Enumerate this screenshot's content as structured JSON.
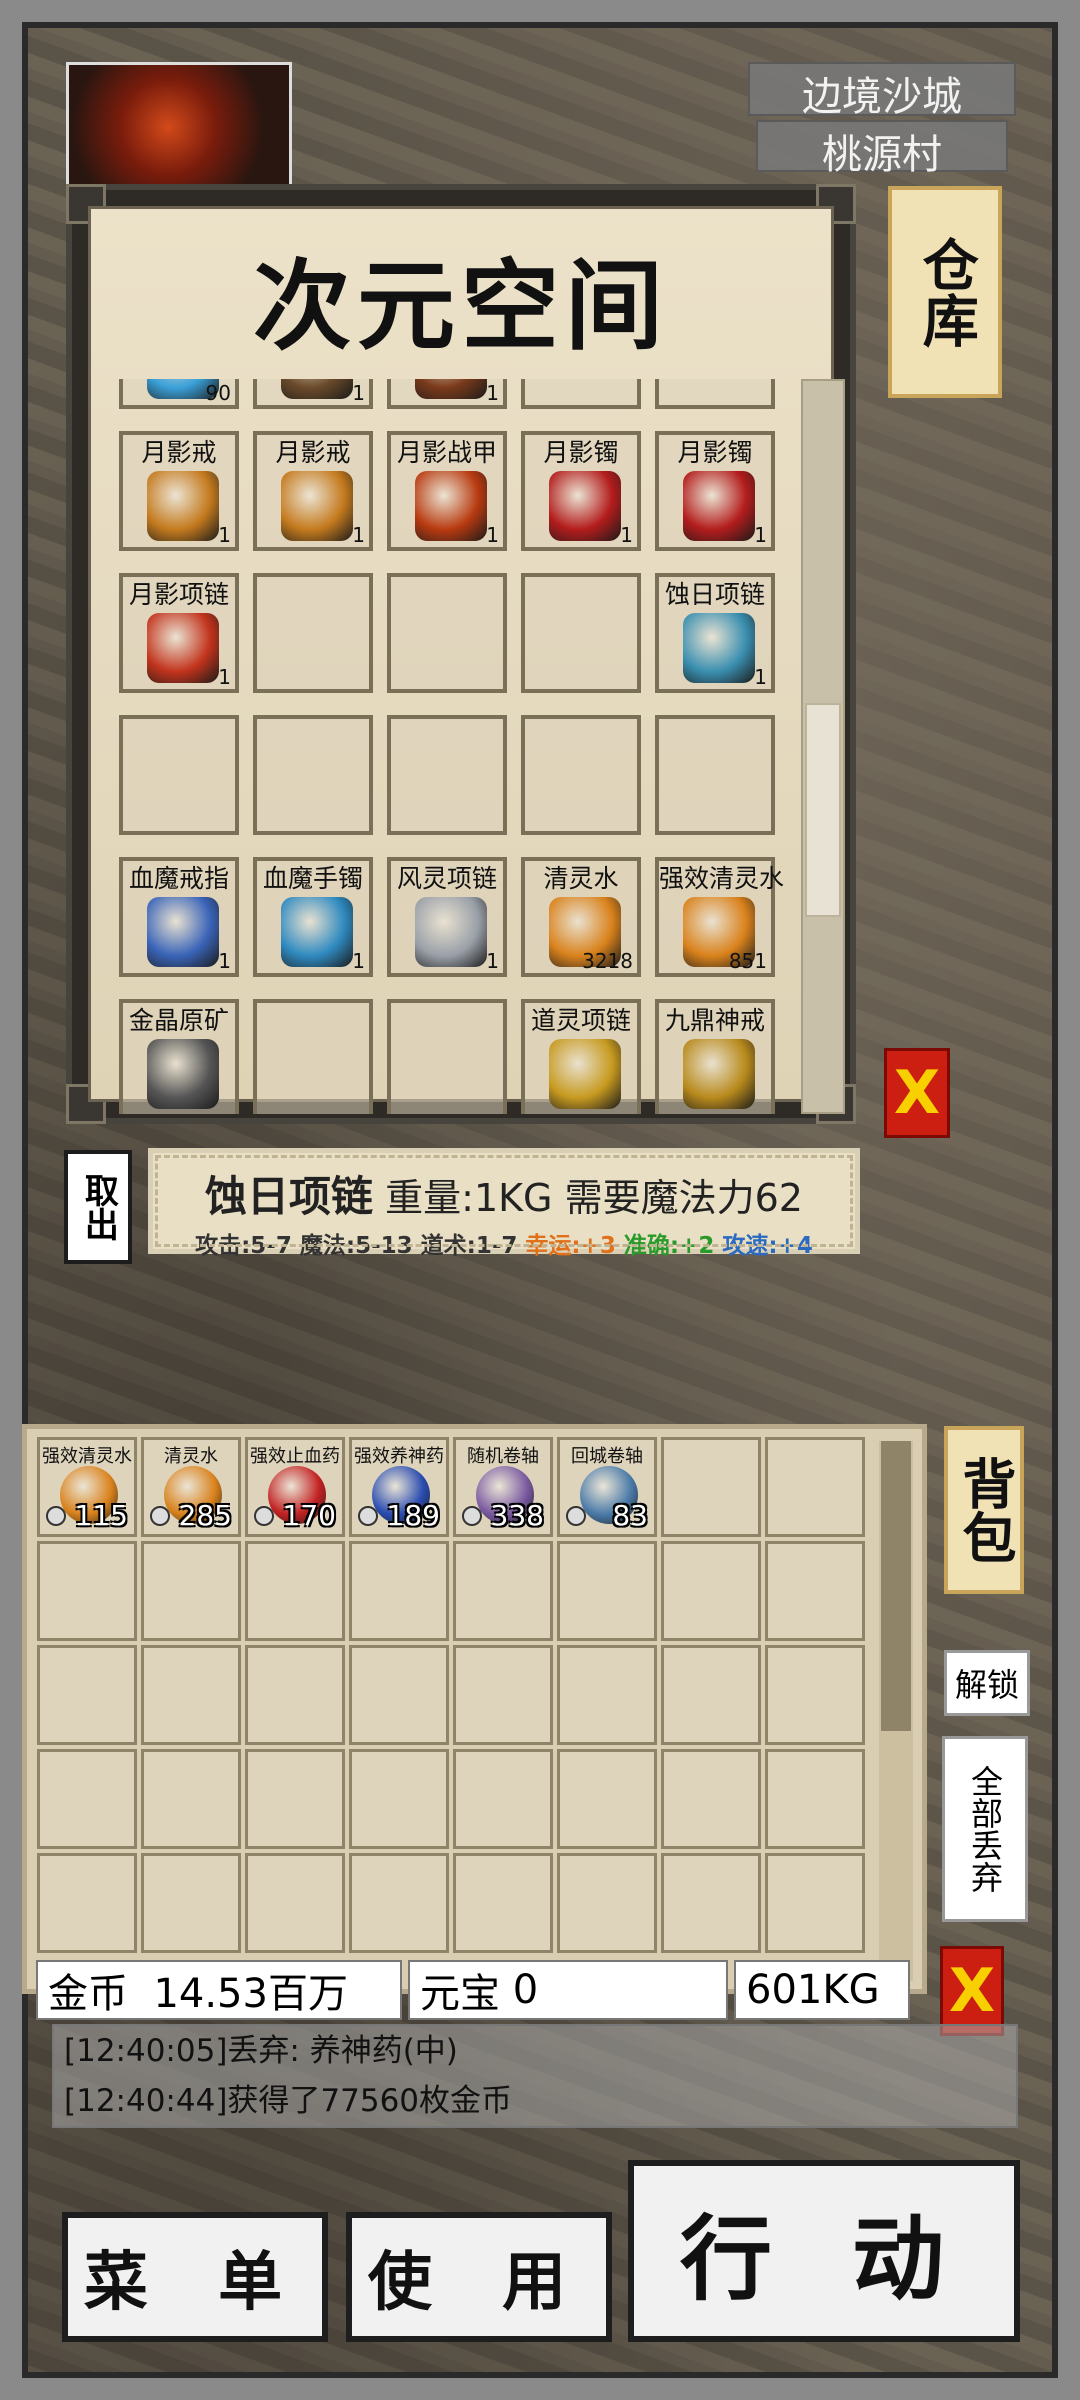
{
  "map": {
    "region": "边境沙城",
    "village": "桃源村"
  },
  "storage": {
    "title": "次元空间",
    "side_button": "仓库",
    "close": "X",
    "rows": [
      [
        {
          "name": "",
          "count": "90",
          "color": "#3aa0d8"
        },
        {
          "name": "",
          "count": "1",
          "color": "#6a4a2a"
        },
        {
          "name": "",
          "count": "1",
          "color": "#7a3a1a"
        },
        {
          "name": "",
          "count": "",
          "color": ""
        },
        {
          "name": "",
          "count": "",
          "color": ""
        }
      ],
      [
        {
          "name": "月影戒",
          "count": "1",
          "color": "#c47a1e"
        },
        {
          "name": "月影戒",
          "count": "1",
          "color": "#c47a1e"
        },
        {
          "name": "月影战甲",
          "count": "1",
          "color": "#b83a10"
        },
        {
          "name": "月影镯",
          "count": "1",
          "color": "#b31c1c"
        },
        {
          "name": "月影镯",
          "count": "1",
          "color": "#b31c1c"
        }
      ],
      [
        {
          "name": "月影项链",
          "count": "1",
          "color": "#c2331c"
        },
        {
          "name": "",
          "count": "",
          "color": ""
        },
        {
          "name": "",
          "count": "",
          "color": ""
        },
        {
          "name": "",
          "count": "",
          "color": ""
        },
        {
          "name": "蚀日项链",
          "count": "1",
          "color": "#3a8fb0"
        }
      ],
      [
        {
          "name": "",
          "count": "",
          "color": ""
        },
        {
          "name": "",
          "count": "",
          "color": ""
        },
        {
          "name": "",
          "count": "",
          "color": ""
        },
        {
          "name": "",
          "count": "",
          "color": ""
        },
        {
          "name": "",
          "count": "",
          "color": ""
        }
      ],
      [
        {
          "name": "血魔戒指",
          "count": "1",
          "color": "#3a64b8"
        },
        {
          "name": "血魔手镯",
          "count": "1",
          "color": "#2f8ac0"
        },
        {
          "name": "风灵项链",
          "count": "1",
          "color": "#9aa0a8"
        },
        {
          "name": "清灵水",
          "count": "3218",
          "color": "#d9821c"
        },
        {
          "name": "强效清灵水",
          "count": "851",
          "color": "#d9821c"
        }
      ],
      [
        {
          "name": "金晶原矿",
          "count": "",
          "color": "#555555"
        },
        {
          "name": "",
          "count": "",
          "color": ""
        },
        {
          "name": "",
          "count": "",
          "color": ""
        },
        {
          "name": "道灵项链",
          "count": "",
          "color": "#c79a20"
        },
        {
          "name": "九鼎神戒",
          "count": "",
          "color": "#b88a1c"
        }
      ]
    ]
  },
  "item_info": {
    "name": "蚀日项链",
    "detail": "重量:1KG 需要魔法力62",
    "stats": "攻击:5-7 魔法:5-13 道术:1-7",
    "luck": "幸运:+3",
    "accuracy": "准确:+2",
    "speed": "攻速:+4",
    "take_out": "取出"
  },
  "bag": {
    "side_button": "背包",
    "unlock": "解锁",
    "drop_all": "全部丢弃",
    "close": "X",
    "items": [
      {
        "name": "强效清灵水",
        "count": "115",
        "color": "#d9821c"
      },
      {
        "name": "清灵水",
        "count": "285",
        "color": "#d9821c"
      },
      {
        "name": "强效止血药",
        "count": "170",
        "color": "#c22222"
      },
      {
        "name": "强效养神药",
        "count": "189",
        "color": "#2a4cb0"
      },
      {
        "name": "随机卷轴",
        "count": "338",
        "color": "#7a5aa0"
      },
      {
        "name": "回城卷轴",
        "count": "83",
        "color": "#4a7aa8"
      }
    ]
  },
  "currency": {
    "gold_label": "金币",
    "gold": "14.53百万",
    "yuanbao_label": "元宝",
    "yuanbao": "0",
    "weight": "601KG"
  },
  "log": [
    "[12:40:05]丢弃: 养神药(中)",
    "[12:40:44]获得了77560枚金币"
  ],
  "buttons": {
    "menu": "菜 单",
    "use": "使 用",
    "action": "行 动"
  }
}
